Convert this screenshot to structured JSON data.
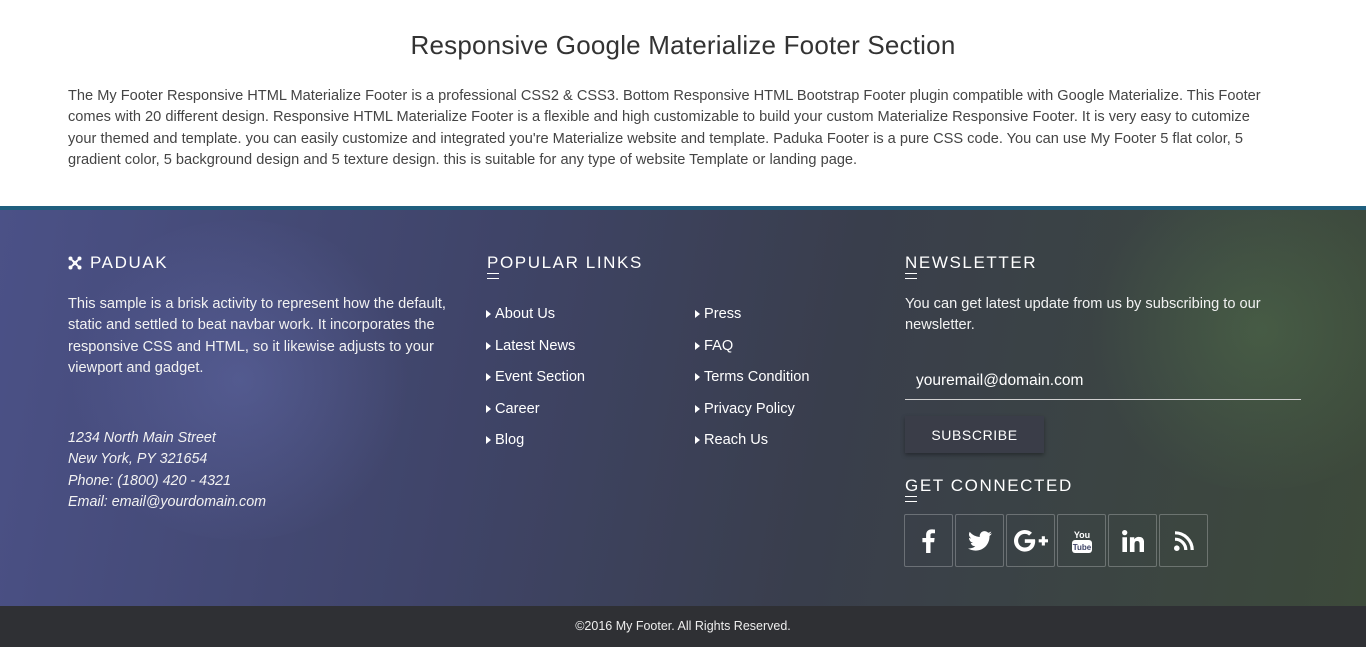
{
  "header": {
    "title": "Responsive Google Materialize Footer Section",
    "description": "The My Footer Responsive HTML Materialize Footer is a professional CSS2 & CSS3. Bottom Responsive HTML Bootstrap Footer plugin compatible with Google Materialize. This Footer comes with 20 different design. Responsive HTML Materialize Footer is a flexible and high customizable to build your custom Materialize Responsive Footer. It is very easy to cutomize your themed and template. you can easily customize and integrated you're Materialize website and template. Paduka Footer is a pure CSS code. You can use My Footer 5 flat color, 5 gradient color, 5 background design and 5 texture design. this is suitable for any type of website Template or landing page."
  },
  "footer": {
    "brand": {
      "name": "PADUAK",
      "icon": "joomla-icon",
      "about": "This sample is a brisk activity to represent how the default, static and settled to beat navbar work. It incorporates the responsive CSS and HTML, so it likewise adjusts to your viewport and gadget.",
      "address": [
        "1234 North Main Street",
        "New York, PY 321654",
        "Phone: (1800) 420 - 4321",
        "Email: email@yourdomain.com"
      ]
    },
    "links": {
      "title": "POPULAR LINKS",
      "col1": [
        "About Us",
        "Latest News",
        "Event Section",
        "Career",
        "Blog"
      ],
      "col2": [
        "Press",
        "FAQ",
        "Terms Condition",
        "Privacy Policy",
        "Reach Us"
      ]
    },
    "newsletter": {
      "title": "NEWSLETTER",
      "text": "You can get latest update from us by subscribing to our newsletter.",
      "email_placeholder": "youremail@domain.com",
      "subscribe_label": "SUBSCRIBE"
    },
    "connect": {
      "title": "GET CONNECTED",
      "icons": [
        "facebook-icon",
        "twitter-icon",
        "google-plus-icon",
        "youtube-icon",
        "linkedin-icon",
        "rss-icon"
      ]
    },
    "copyright": "©2016 My Footer. All Rights Reserved.",
    "colors": {
      "top_border": "#1f5f7e",
      "bottom_bar": "#2f3034"
    }
  }
}
